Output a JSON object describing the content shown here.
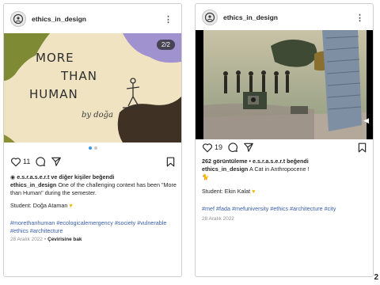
{
  "left_post": {
    "username": "ethics_in_design",
    "more_icon": "more-icon",
    "slide_indicator": "2/2",
    "artwork": {
      "line1": "MORE",
      "line2": "THAN",
      "line3": "HUMAN",
      "signature": "by doğa"
    },
    "like_count": "11",
    "liked_by": "e.s.r.a.s.e.r.t ve diğer kişiler beğendi",
    "caption_user": "ethics_in_design",
    "caption_text": "One of the challenging context has been \"More than Human\" during the semester.",
    "student": "Student: Doğa Ataman",
    "hashtags": "#morethanhuman #ecologicalemergency #society #vulnerable #ethics #architecture",
    "date": "28 Aralık 2022",
    "separator": "•",
    "translate": "Çevirisine bak"
  },
  "right_post": {
    "username": "ethics_in_design",
    "more_icon": "more-icon",
    "like_count": "19",
    "views": "262 görüntüleme • e.s.r.a.s.e.r.t beğendi",
    "caption_user": "ethics_in_design",
    "caption_text": "A Cat in Anthropocene !",
    "cat_emoji": "🐈",
    "student": "Student: Ekin Kalat",
    "hashtags": "#mef #fada #mefuniversity #ethics #architecture #city",
    "date": "28 Aralık 2022"
  },
  "page_number": "2"
}
